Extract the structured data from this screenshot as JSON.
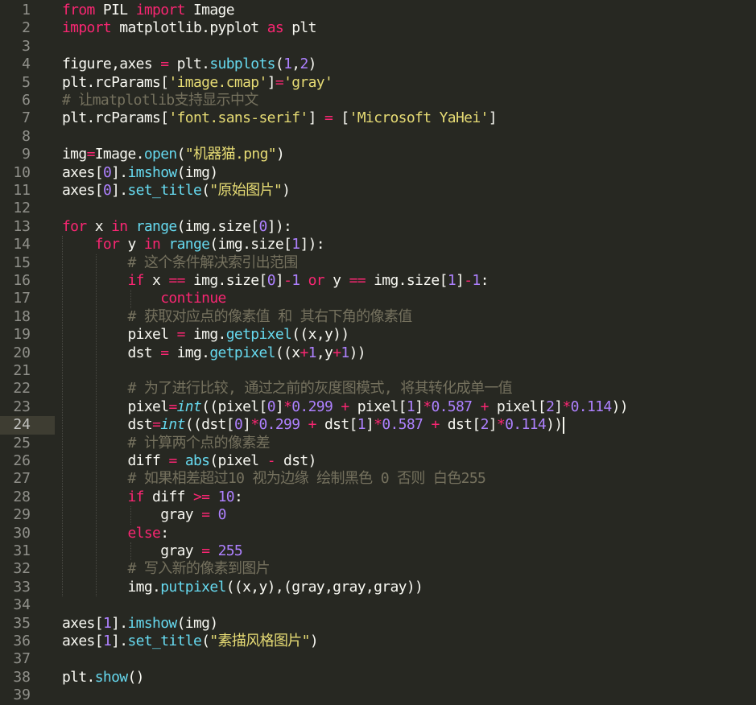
{
  "editor": {
    "theme_colors": {
      "background": "#272822",
      "keyword": "#f92672",
      "function": "#66d9ef",
      "string": "#e6db74",
      "number": "#ae81ff",
      "comment": "#75715e",
      "text": "#f8f8f2",
      "line_number": "#90908a"
    },
    "active_line": 24,
    "lines": [
      {
        "n": "1",
        "tokens": [
          [
            "kw",
            "from"
          ],
          [
            "pl",
            " PIL "
          ],
          [
            "kw",
            "import"
          ],
          [
            "pl",
            " Image"
          ]
        ]
      },
      {
        "n": "2",
        "tokens": [
          [
            "kw",
            "import"
          ],
          [
            "pl",
            " matplotlib.pyplot "
          ],
          [
            "kw",
            "as"
          ],
          [
            "pl",
            " plt"
          ]
        ]
      },
      {
        "n": "3",
        "tokens": []
      },
      {
        "n": "4",
        "tokens": [
          [
            "pl",
            "figure,axes "
          ],
          [
            "op",
            "="
          ],
          [
            "pl",
            " plt."
          ],
          [
            "fn",
            "subplots"
          ],
          [
            "pl",
            "("
          ],
          [
            "nu",
            "1"
          ],
          [
            "pl",
            ","
          ],
          [
            "nu",
            "2"
          ],
          [
            "pl",
            ")"
          ]
        ]
      },
      {
        "n": "5",
        "tokens": [
          [
            "pl",
            "plt.rcParams["
          ],
          [
            "st",
            "'image.cmap'"
          ],
          [
            "pl",
            "]"
          ],
          [
            "op",
            "="
          ],
          [
            "st",
            "'gray'"
          ]
        ]
      },
      {
        "n": "6",
        "tokens": [
          [
            "cm",
            "# 让matplotlib支持显示中文"
          ]
        ]
      },
      {
        "n": "7",
        "tokens": [
          [
            "pl",
            "plt.rcParams["
          ],
          [
            "st",
            "'font.sans-serif'"
          ],
          [
            "pl",
            "] "
          ],
          [
            "op",
            "="
          ],
          [
            "pl",
            " ["
          ],
          [
            "st",
            "'Microsoft YaHei'"
          ],
          [
            "pl",
            "]"
          ]
        ]
      },
      {
        "n": "8",
        "tokens": []
      },
      {
        "n": "9",
        "tokens": [
          [
            "pl",
            "img"
          ],
          [
            "op",
            "="
          ],
          [
            "pl",
            "Image."
          ],
          [
            "fn",
            "open"
          ],
          [
            "pl",
            "("
          ],
          [
            "st",
            "\"机器猫.png\""
          ],
          [
            "pl",
            ")"
          ]
        ]
      },
      {
        "n": "10",
        "tokens": [
          [
            "pl",
            "axes["
          ],
          [
            "nu",
            "0"
          ],
          [
            "pl",
            "]."
          ],
          [
            "fn",
            "imshow"
          ],
          [
            "pl",
            "(img)"
          ]
        ]
      },
      {
        "n": "11",
        "tokens": [
          [
            "pl",
            "axes["
          ],
          [
            "nu",
            "0"
          ],
          [
            "pl",
            "]."
          ],
          [
            "fn",
            "set_title"
          ],
          [
            "pl",
            "("
          ],
          [
            "st",
            "\"原始图片\""
          ],
          [
            "pl",
            ")"
          ]
        ]
      },
      {
        "n": "12",
        "tokens": []
      },
      {
        "n": "13",
        "tokens": [
          [
            "kw",
            "for"
          ],
          [
            "pl",
            " x "
          ],
          [
            "kw",
            "in"
          ],
          [
            "pl",
            " "
          ],
          [
            "fn",
            "range"
          ],
          [
            "pl",
            "(img.size["
          ],
          [
            "nu",
            "0"
          ],
          [
            "pl",
            "]):"
          ]
        ]
      },
      {
        "n": "14",
        "tokens": [
          [
            "pl",
            "    "
          ],
          [
            "kw",
            "for"
          ],
          [
            "pl",
            " y "
          ],
          [
            "kw",
            "in"
          ],
          [
            "pl",
            " "
          ],
          [
            "fn",
            "range"
          ],
          [
            "pl",
            "(img.size["
          ],
          [
            "nu",
            "1"
          ],
          [
            "pl",
            "]):"
          ]
        ]
      },
      {
        "n": "15",
        "tokens": [
          [
            "pl",
            "        "
          ],
          [
            "cm",
            "# 这个条件解决索引出范围"
          ]
        ]
      },
      {
        "n": "16",
        "tokens": [
          [
            "pl",
            "        "
          ],
          [
            "kw",
            "if"
          ],
          [
            "pl",
            " x "
          ],
          [
            "op",
            "=="
          ],
          [
            "pl",
            " img.size["
          ],
          [
            "nu",
            "0"
          ],
          [
            "pl",
            "]"
          ],
          [
            "op",
            "-"
          ],
          [
            "nu",
            "1"
          ],
          [
            "pl",
            " "
          ],
          [
            "kw",
            "or"
          ],
          [
            "pl",
            " y "
          ],
          [
            "op",
            "=="
          ],
          [
            "pl",
            " img.size["
          ],
          [
            "nu",
            "1"
          ],
          [
            "pl",
            "]"
          ],
          [
            "op",
            "-"
          ],
          [
            "nu",
            "1"
          ],
          [
            "pl",
            ":"
          ]
        ]
      },
      {
        "n": "17",
        "tokens": [
          [
            "pl",
            "            "
          ],
          [
            "kw",
            "continue"
          ]
        ]
      },
      {
        "n": "18",
        "tokens": [
          [
            "pl",
            "        "
          ],
          [
            "cm",
            "# 获取对应点的像素值 和 其右下角的像素值"
          ]
        ]
      },
      {
        "n": "19",
        "tokens": [
          [
            "pl",
            "        pixel "
          ],
          [
            "op",
            "="
          ],
          [
            "pl",
            " img."
          ],
          [
            "fn",
            "getpixel"
          ],
          [
            "pl",
            "((x,y))"
          ]
        ]
      },
      {
        "n": "20",
        "tokens": [
          [
            "pl",
            "        dst "
          ],
          [
            "op",
            "="
          ],
          [
            "pl",
            " img."
          ],
          [
            "fn",
            "getpixel"
          ],
          [
            "pl",
            "((x"
          ],
          [
            "op",
            "+"
          ],
          [
            "nu",
            "1"
          ],
          [
            "pl",
            ",y"
          ],
          [
            "op",
            "+"
          ],
          [
            "nu",
            "1"
          ],
          [
            "pl",
            "))"
          ]
        ]
      },
      {
        "n": "21",
        "tokens": []
      },
      {
        "n": "22",
        "tokens": [
          [
            "pl",
            "        "
          ],
          [
            "cm",
            "# 为了进行比较, 通过之前的灰度图模式, 将其转化成单一值"
          ]
        ]
      },
      {
        "n": "23",
        "tokens": [
          [
            "pl",
            "        pixel"
          ],
          [
            "op",
            "="
          ],
          [
            "it",
            "int"
          ],
          [
            "pl",
            "((pixel["
          ],
          [
            "nu",
            "0"
          ],
          [
            "pl",
            "]"
          ],
          [
            "op",
            "*"
          ],
          [
            "nu",
            "0.299"
          ],
          [
            "pl",
            " "
          ],
          [
            "op",
            "+"
          ],
          [
            "pl",
            " pixel["
          ],
          [
            "nu",
            "1"
          ],
          [
            "pl",
            "]"
          ],
          [
            "op",
            "*"
          ],
          [
            "nu",
            "0.587"
          ],
          [
            "pl",
            " "
          ],
          [
            "op",
            "+"
          ],
          [
            "pl",
            " pixel["
          ],
          [
            "nu",
            "2"
          ],
          [
            "pl",
            "]"
          ],
          [
            "op",
            "*"
          ],
          [
            "nu",
            "0.114"
          ],
          [
            "pl",
            "))"
          ]
        ]
      },
      {
        "n": "24",
        "tokens": [
          [
            "pl",
            "        dst"
          ],
          [
            "op",
            "="
          ],
          [
            "it",
            "int"
          ],
          [
            "pl",
            "((dst["
          ],
          [
            "nu",
            "0"
          ],
          [
            "pl",
            "]"
          ],
          [
            "op",
            "*"
          ],
          [
            "nu",
            "0.299"
          ],
          [
            "pl",
            " "
          ],
          [
            "op",
            "+"
          ],
          [
            "pl",
            " dst["
          ],
          [
            "nu",
            "1"
          ],
          [
            "pl",
            "]"
          ],
          [
            "op",
            "*"
          ],
          [
            "nu",
            "0.587"
          ],
          [
            "pl",
            " "
          ],
          [
            "op",
            "+"
          ],
          [
            "pl",
            " dst["
          ],
          [
            "nu",
            "2"
          ],
          [
            "pl",
            "]"
          ],
          [
            "op",
            "*"
          ],
          [
            "nu",
            "0.114"
          ],
          [
            "pl",
            "))"
          ]
        ]
      },
      {
        "n": "25",
        "tokens": [
          [
            "pl",
            "        "
          ],
          [
            "cm",
            "# 计算两个点的像素差"
          ]
        ]
      },
      {
        "n": "26",
        "tokens": [
          [
            "pl",
            "        diff "
          ],
          [
            "op",
            "="
          ],
          [
            "pl",
            " "
          ],
          [
            "fn",
            "abs"
          ],
          [
            "pl",
            "(pixel "
          ],
          [
            "op",
            "-"
          ],
          [
            "pl",
            " dst)"
          ]
        ]
      },
      {
        "n": "27",
        "tokens": [
          [
            "pl",
            "        "
          ],
          [
            "cm",
            "# 如果相差超过10 视为边缘 绘制黑色 0 否则 白色255"
          ]
        ]
      },
      {
        "n": "28",
        "tokens": [
          [
            "pl",
            "        "
          ],
          [
            "kw",
            "if"
          ],
          [
            "pl",
            " diff "
          ],
          [
            "op",
            ">="
          ],
          [
            "pl",
            " "
          ],
          [
            "nu",
            "10"
          ],
          [
            "pl",
            ":"
          ]
        ]
      },
      {
        "n": "29",
        "tokens": [
          [
            "pl",
            "            gray "
          ],
          [
            "op",
            "="
          ],
          [
            "pl",
            " "
          ],
          [
            "nu",
            "0"
          ]
        ]
      },
      {
        "n": "30",
        "tokens": [
          [
            "pl",
            "        "
          ],
          [
            "kw",
            "else"
          ],
          [
            "pl",
            ":"
          ]
        ]
      },
      {
        "n": "31",
        "tokens": [
          [
            "pl",
            "            gray "
          ],
          [
            "op",
            "="
          ],
          [
            "pl",
            " "
          ],
          [
            "nu",
            "255"
          ]
        ]
      },
      {
        "n": "32",
        "tokens": [
          [
            "pl",
            "        "
          ],
          [
            "cm",
            "# 写入新的像素到图片"
          ]
        ]
      },
      {
        "n": "33",
        "tokens": [
          [
            "pl",
            "        img."
          ],
          [
            "fn",
            "putpixel"
          ],
          [
            "pl",
            "((x,y),(gray,gray,gray))"
          ]
        ]
      },
      {
        "n": "34",
        "tokens": []
      },
      {
        "n": "35",
        "tokens": [
          [
            "pl",
            "axes["
          ],
          [
            "nu",
            "1"
          ],
          [
            "pl",
            "]."
          ],
          [
            "fn",
            "imshow"
          ],
          [
            "pl",
            "(img)"
          ]
        ]
      },
      {
        "n": "36",
        "tokens": [
          [
            "pl",
            "axes["
          ],
          [
            "nu",
            "1"
          ],
          [
            "pl",
            "]."
          ],
          [
            "fn",
            "set_title"
          ],
          [
            "pl",
            "("
          ],
          [
            "st",
            "\"素描风格图片\""
          ],
          [
            "pl",
            ")"
          ]
        ]
      },
      {
        "n": "37",
        "tokens": []
      },
      {
        "n": "38",
        "tokens": [
          [
            "pl",
            "plt."
          ],
          [
            "fn",
            "show"
          ],
          [
            "pl",
            "()"
          ]
        ]
      },
      {
        "n": "39",
        "tokens": []
      }
    ]
  }
}
